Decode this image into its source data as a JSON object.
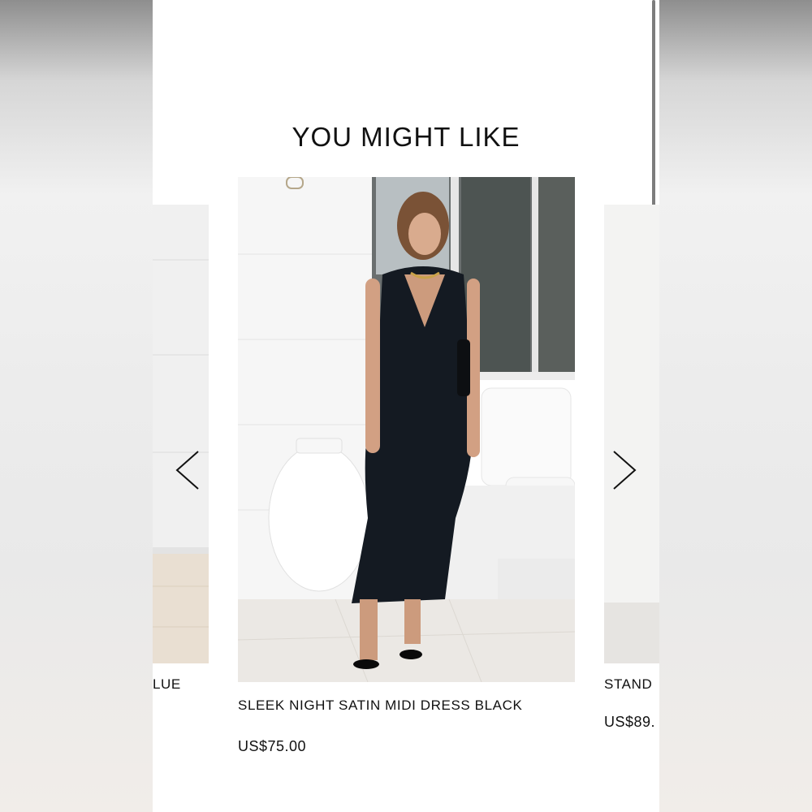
{
  "section": {
    "title": "YOU MIGHT LIKE"
  },
  "carousel": {
    "prev_icon": "chevron-left-icon",
    "next_icon": "chevron-right-icon",
    "items": [
      {
        "name": "LUE",
        "price": ""
      },
      {
        "name": "SLEEK NIGHT SATIN MIDI DRESS BLACK",
        "price": "US$75.00"
      },
      {
        "name": "STAND",
        "price": "US$89."
      }
    ]
  }
}
